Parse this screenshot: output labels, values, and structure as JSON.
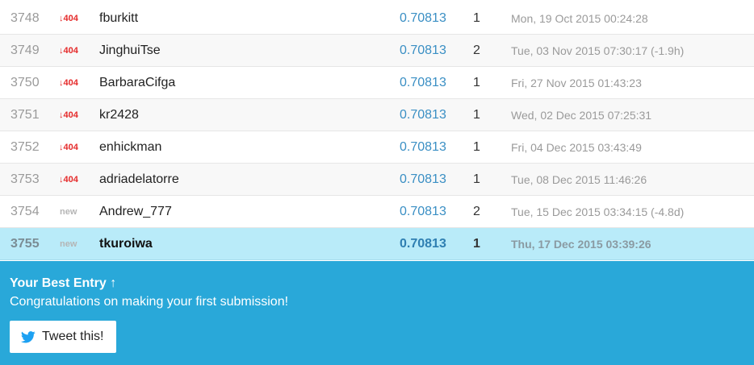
{
  "leaderboard": {
    "rows": [
      {
        "rank": "3748",
        "delta": "↓404",
        "delta_type": "down",
        "team": "fburkitt",
        "score": "0.70813",
        "entries": "1",
        "last": "Mon, 19 Oct 2015 00:24:28"
      },
      {
        "rank": "3749",
        "delta": "↓404",
        "delta_type": "down",
        "team": "JinghuiTse",
        "score": "0.70813",
        "entries": "2",
        "last": "Tue, 03 Nov 2015 07:30:17 (-1.9h)"
      },
      {
        "rank": "3750",
        "delta": "↓404",
        "delta_type": "down",
        "team": "BarbaraCifga",
        "score": "0.70813",
        "entries": "1",
        "last": "Fri, 27 Nov 2015 01:43:23"
      },
      {
        "rank": "3751",
        "delta": "↓404",
        "delta_type": "down",
        "team": "kr2428",
        "score": "0.70813",
        "entries": "1",
        "last": "Wed, 02 Dec 2015 07:25:31"
      },
      {
        "rank": "3752",
        "delta": "↓404",
        "delta_type": "down",
        "team": "enhickman",
        "score": "0.70813",
        "entries": "1",
        "last": "Fri, 04 Dec 2015 03:43:49"
      },
      {
        "rank": "3753",
        "delta": "↓404",
        "delta_type": "down",
        "team": "adriadelatorre",
        "score": "0.70813",
        "entries": "1",
        "last": "Tue, 08 Dec 2015 11:46:26"
      },
      {
        "rank": "3754",
        "delta": "new",
        "delta_type": "new",
        "team": "Andrew_777",
        "score": "0.70813",
        "entries": "2",
        "last": "Tue, 15 Dec 2015 03:34:15 (-4.8d)"
      },
      {
        "rank": "3755",
        "delta": "new",
        "delta_type": "new",
        "team": "tkuroiwa",
        "score": "0.70813",
        "entries": "1",
        "last": "Thu, 17 Dec 2015 03:39:26",
        "highlight": true
      }
    ]
  },
  "banner": {
    "title": "Your Best Entry",
    "arrow": "↑",
    "message": "Congratulations on making your first submission!",
    "tweet_label": "Tweet this!",
    "tweet_icon": "twitter-bird-icon"
  },
  "colors": {
    "banner_bg": "#29a8d9",
    "highlight_row": "#b9ebf9",
    "score": "#3a8fc4",
    "drop": "#e52a2a"
  }
}
